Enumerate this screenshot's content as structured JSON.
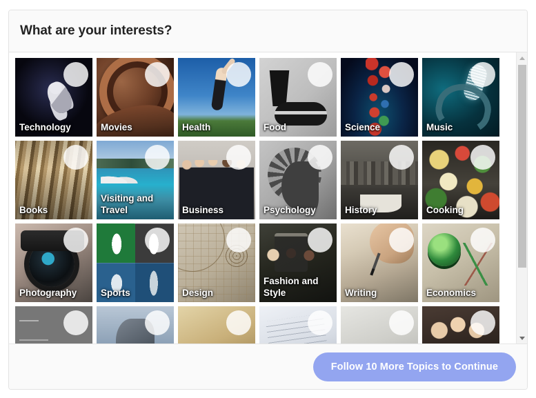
{
  "panel": {
    "title": "What are your interests?"
  },
  "footer": {
    "continue_label": "Follow 10 More Topics to Continue",
    "accent_color": "#93a5f0"
  },
  "scrollbar": {
    "up_arrow_icon": "caret-up-icon",
    "down_arrow_icon": "caret-down-icon",
    "thumb_position_percent": 0,
    "thumb_size_percent": 67
  },
  "grid": {
    "columns": 6,
    "follow_toggle_icon": "follow-circle-icon",
    "topics": [
      {
        "label": "Technology",
        "art": "art-technology",
        "follow_state": "not-following"
      },
      {
        "label": "Movies",
        "art": "art-movies",
        "follow_state": "not-following"
      },
      {
        "label": "Health",
        "art": "art-health",
        "follow_state": "not-following"
      },
      {
        "label": "Food",
        "art": "art-food",
        "follow_state": "not-following"
      },
      {
        "label": "Science",
        "art": "art-science",
        "follow_state": "not-following"
      },
      {
        "label": "Music",
        "art": "art-music",
        "follow_state": "not-following"
      },
      {
        "label": "Books",
        "art": "art-books",
        "follow_state": "not-following"
      },
      {
        "label": "Visiting and Travel",
        "art": "art-travel",
        "follow_state": "not-following"
      },
      {
        "label": "Business",
        "art": "art-business",
        "follow_state": "not-following"
      },
      {
        "label": "Psychology",
        "art": "art-psychology",
        "follow_state": "not-following"
      },
      {
        "label": "History",
        "art": "art-history",
        "follow_state": "not-following"
      },
      {
        "label": "Cooking",
        "art": "art-cooking",
        "follow_state": "not-following"
      },
      {
        "label": "Photography",
        "art": "art-photography",
        "follow_state": "not-following"
      },
      {
        "label": "Sports",
        "art": "art-sports",
        "follow_state": "not-following"
      },
      {
        "label": "Design",
        "art": "art-design",
        "follow_state": "not-following"
      },
      {
        "label": "Fashion and Style",
        "art": "art-fashion",
        "follow_state": "not-following"
      },
      {
        "label": "Writing",
        "art": "art-writing",
        "follow_state": "not-following"
      },
      {
        "label": "Economics",
        "art": "art-economics",
        "follow_state": "not-following"
      },
      {
        "label": "",
        "art": "art-math",
        "follow_state": "not-following"
      },
      {
        "label": "",
        "art": "art-philosophy",
        "follow_state": "not-following"
      },
      {
        "label": "",
        "art": "art-law",
        "follow_state": "not-following"
      },
      {
        "label": "",
        "art": "art-finance",
        "follow_state": "not-following"
      },
      {
        "label": "",
        "art": "art-marketing",
        "follow_state": "not-following"
      },
      {
        "label": "",
        "art": "art-relationships",
        "follow_state": "not-following"
      }
    ]
  }
}
